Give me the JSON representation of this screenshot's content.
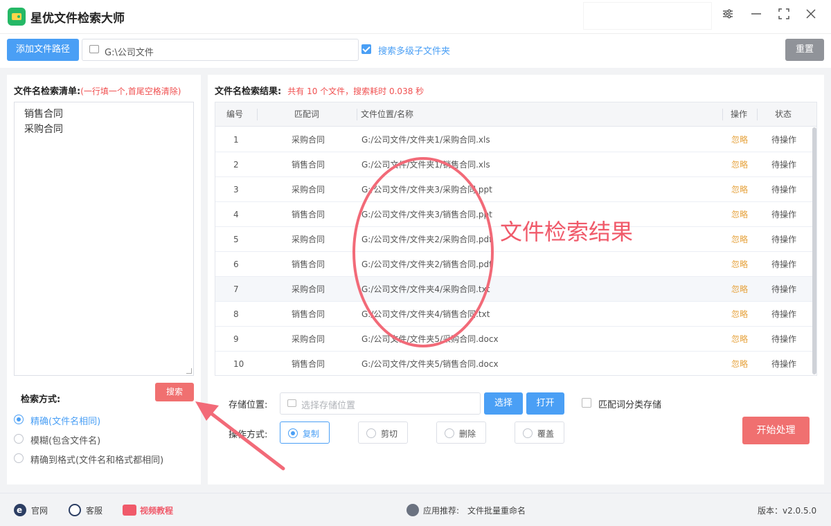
{
  "app": {
    "title": "星优文件检索大师"
  },
  "toolbar": {
    "add_path_label": "添加文件路径",
    "path_value": "G:\\公司文件",
    "subfolder_label": "搜索多级子文件夹",
    "subfolder_checked": true,
    "reset_label": "重置"
  },
  "left": {
    "list_title": "文件名检索清单:",
    "list_hint": "(一行填一个,首尾空格清除)",
    "list_lines": [
      "销售合同",
      "采购合同"
    ],
    "method_title": "检索方式:",
    "search_label": "搜索",
    "methods": [
      {
        "label": "精确(文件名相同)",
        "selected": true
      },
      {
        "label": "模糊(包含文件名)",
        "selected": false
      },
      {
        "label": "精确到格式(文件名和格式都相同)",
        "selected": false
      }
    ]
  },
  "results": {
    "title": "文件名检索结果:",
    "summary": "共有 10 个文件，搜索耗时 0.038 秒",
    "columns": [
      "编号",
      "匹配词",
      "文件位置/名称",
      "操作",
      "状态"
    ],
    "rows": [
      [
        "1",
        "采购合同",
        "G:/公司文件/文件夹1/采购合同.xls",
        "忽略",
        "待操作"
      ],
      [
        "2",
        "销售合同",
        "G:/公司文件/文件夹1/销售合同.xls",
        "忽略",
        "待操作"
      ],
      [
        "3",
        "采购合同",
        "G:/公司文件/文件夹3/采购合同.ppt",
        "忽略",
        "待操作"
      ],
      [
        "4",
        "销售合同",
        "G:/公司文件/文件夹3/销售合同.ppt",
        "忽略",
        "待操作"
      ],
      [
        "5",
        "采购合同",
        "G:/公司文件/文件夹2/采购合同.pdf",
        "忽略",
        "待操作"
      ],
      [
        "6",
        "销售合同",
        "G:/公司文件/文件夹2/销售合同.pdf",
        "忽略",
        "待操作"
      ],
      [
        "7",
        "采购合同",
        "G:/公司文件/文件夹4/采购合同.txt",
        "忽略",
        "待操作"
      ],
      [
        "8",
        "销售合同",
        "G:/公司文件/文件夹4/销售合同.txt",
        "忽略",
        "待操作"
      ],
      [
        "9",
        "采购合同",
        "G:/公司文件/文件夹5/采购合同.docx",
        "忽略",
        "待操作"
      ],
      [
        "10",
        "销售合同",
        "G:/公司文件/文件夹5/销售合同.docx",
        "忽略",
        "待操作"
      ]
    ],
    "highlight_row": 7
  },
  "storage": {
    "label": "存储位置:",
    "placeholder": "选择存储位置",
    "choose_label": "选择",
    "open_label": "打开",
    "classify_label": "匹配词分类存储",
    "classify_checked": false
  },
  "operation": {
    "label": "操作方式:",
    "options": [
      {
        "label": "复制",
        "selected": true
      },
      {
        "label": "剪切",
        "selected": false
      },
      {
        "label": "删除",
        "selected": false
      },
      {
        "label": "覆盖",
        "selected": false
      }
    ],
    "start_label": "开始处理"
  },
  "annotation": {
    "text": "文件检索结果"
  },
  "status": {
    "website": "官网",
    "support": "客服",
    "tutorial": "视频教程",
    "recommend_prefix": "应用推荐:",
    "recommend_app": "文件批量重命名",
    "version": "版本：v2.0.5.0"
  },
  "colors": {
    "primary": "#4a9ff5",
    "danger": "#f07070",
    "warning": "#e6a23c",
    "annotation": "#f05a6a"
  }
}
